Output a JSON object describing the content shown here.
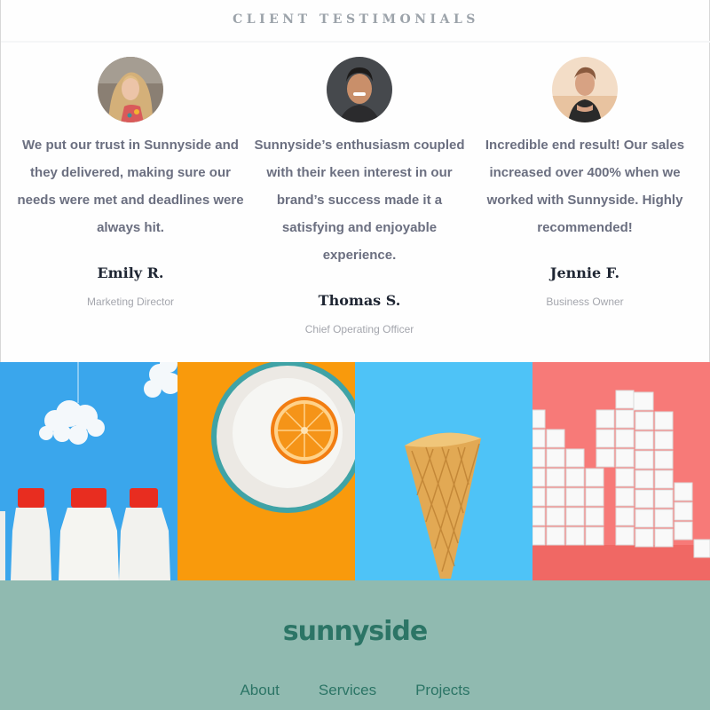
{
  "section": {
    "title": "CLIENT TESTIMONIALS"
  },
  "testimonials": [
    {
      "quote": "We put our trust in Sunnyside and they delivered, making sure our needs were met and deadlines were always hit.",
      "name": "Emily R.",
      "role": "Marketing Director"
    },
    {
      "quote": "Sunnyside’s enthusiasm coupled with their keen interest in our brand’s success made it a satisfying and enjoyable experience.",
      "name": "Thomas S.",
      "role": "Chief Operating Officer"
    },
    {
      "quote": "Incredible end result! Our sales increased over 400% when we worked with Sunnyside. Highly recommended!",
      "name": "Jennie F.",
      "role": "Business Owner"
    }
  ],
  "gallery": [
    {
      "icon": "milk-bottles-image",
      "bg": "#3aa6ec"
    },
    {
      "icon": "orange-plate-image",
      "bg": "#f99a0c"
    },
    {
      "icon": "ice-cream-cone-image",
      "bg": "#4ec3f7"
    },
    {
      "icon": "sugar-cubes-image",
      "bg": "#f77a78"
    }
  ],
  "footer": {
    "brand": "sunnyside",
    "links": [
      "About",
      "Services",
      "Projects"
    ]
  },
  "colors": {
    "footer_bg": "#90bab0",
    "footer_text": "#2c7566",
    "quote_text": "#6b6f80",
    "name_text": "#1f2633",
    "role_text": "#a4a6ad"
  }
}
